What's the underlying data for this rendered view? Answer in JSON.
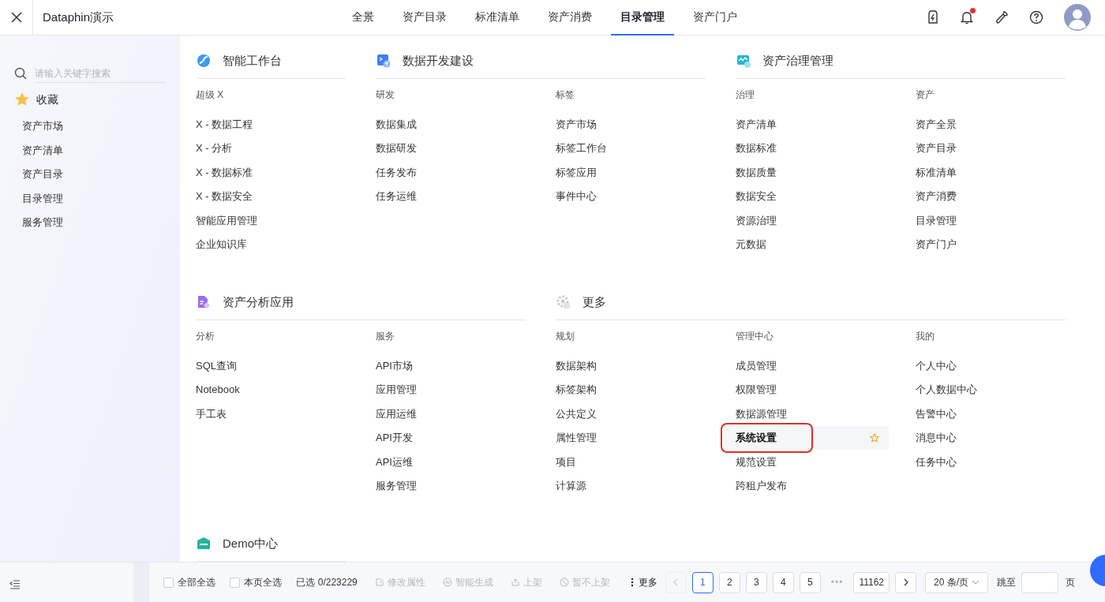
{
  "header": {
    "title": "Dataphin演示",
    "tabs": [
      {
        "label": "全景",
        "selected": false
      },
      {
        "label": "资产目录",
        "selected": false
      },
      {
        "label": "标准清单",
        "selected": false
      },
      {
        "label": "资产消费",
        "selected": false
      },
      {
        "label": "目录管理",
        "selected": true
      },
      {
        "label": "资产门户",
        "selected": false
      }
    ],
    "notification_dot": true
  },
  "sidebar": {
    "search": {
      "placeholder": "请输入关键字搜索"
    },
    "favorites": {
      "label": "收藏"
    },
    "items": [
      "资产市场",
      "资产清单",
      "资产目录",
      "目录管理",
      "服务管理"
    ]
  },
  "sections": [
    {
      "title": "智能工作台",
      "kind": "workbench",
      "groups": [
        {
          "title": "超级 X",
          "items": [
            {
              "label": "X - 数据工程",
              "hovered": false
            },
            {
              "label": "X - 分析",
              "hovered": false
            },
            {
              "label": "X - 数据标准",
              "hovered": false
            },
            {
              "label": "X - 数据安全",
              "hovered": false
            },
            {
              "label": "智能应用管理",
              "hovered": false
            },
            {
              "label": "企业知识库",
              "hovered": false
            }
          ]
        }
      ]
    },
    {
      "title": "数据开发建设",
      "kind": "develop",
      "groups": [
        {
          "title": "研发",
          "items": [
            {
              "label": "数据集成",
              "hovered": false
            },
            {
              "label": "数据研发",
              "hovered": false
            },
            {
              "label": "任务发布",
              "hovered": false
            },
            {
              "label": "任务运维",
              "hovered": false
            }
          ]
        },
        {
          "title": "标签",
          "items": [
            {
              "label": "资产市场",
              "hovered": false
            },
            {
              "label": "标签工作台",
              "hovered": false
            },
            {
              "label": "标签应用",
              "hovered": false
            },
            {
              "label": "事件中心",
              "hovered": false
            }
          ]
        }
      ]
    },
    {
      "title": "资产治理管理",
      "kind": "governance",
      "groups": [
        {
          "title": "治理",
          "items": [
            {
              "label": "资产清单",
              "hovered": false
            },
            {
              "label": "数据标准",
              "hovered": false
            },
            {
              "label": "数据质量",
              "hovered": false
            },
            {
              "label": "数据安全",
              "hovered": false
            },
            {
              "label": "资源治理",
              "hovered": false
            },
            {
              "label": "元数据",
              "hovered": false
            }
          ]
        },
        {
          "title": "资产",
          "items": [
            {
              "label": "资产全景",
              "hovered": false
            },
            {
              "label": "资产目录",
              "hovered": false
            },
            {
              "label": "标准清单",
              "hovered": false
            },
            {
              "label": "资产消费",
              "hovered": false
            },
            {
              "label": "目录管理",
              "hovered": false
            },
            {
              "label": "资产门户",
              "hovered": false
            }
          ]
        }
      ]
    },
    {
      "title": "资产分析应用",
      "kind": "analysis",
      "groups": [
        {
          "title": "分析",
          "items": [
            {
              "label": "SQL查询",
              "hovered": false
            },
            {
              "label": "Notebook",
              "hovered": false
            },
            {
              "label": "手工表",
              "hovered": false
            }
          ]
        },
        {
          "title": "服务",
          "items": [
            {
              "label": "API市场",
              "hovered": false
            },
            {
              "label": "应用管理",
              "hovered": false
            },
            {
              "label": "应用运维",
              "hovered": false
            },
            {
              "label": "API开发",
              "hovered": false
            },
            {
              "label": "API运维",
              "hovered": false
            },
            {
              "label": "服务管理",
              "hovered": false
            }
          ]
        }
      ]
    },
    {
      "title": "更多",
      "kind": "more",
      "groups": [
        {
          "title": "规划",
          "items": [
            {
              "label": "数据架构",
              "hovered": false
            },
            {
              "label": "标签架构",
              "hovered": false
            },
            {
              "label": "公共定义",
              "hovered": false
            },
            {
              "label": "属性管理",
              "hovered": false
            },
            {
              "label": "项目",
              "hovered": false
            },
            {
              "label": "计算源",
              "hovered": false
            }
          ]
        },
        {
          "title": "管理中心",
          "items": [
            {
              "label": "成员管理",
              "hovered": false
            },
            {
              "label": "权限管理",
              "hovered": false
            },
            {
              "label": "数据源管理",
              "hovered": false
            },
            {
              "label": "系统设置",
              "hovered": true
            },
            {
              "label": "规范设置",
              "hovered": false
            },
            {
              "label": "跨租户发布",
              "hovered": false
            }
          ]
        },
        {
          "title": "我的",
          "items": [
            {
              "label": "个人中心",
              "hovered": false
            },
            {
              "label": "个人数据中心",
              "hovered": false
            },
            {
              "label": "告警中心",
              "hovered": false
            },
            {
              "label": "消息中心",
              "hovered": false
            },
            {
              "label": "任务中心",
              "hovered": false
            }
          ]
        }
      ]
    },
    {
      "title": "Demo中心",
      "kind": "demo"
    }
  ],
  "toolbar": {
    "checks": [
      {
        "label": "全部全选",
        "checked": false
      },
      {
        "label": "本页全选",
        "checked": false
      }
    ],
    "selected_count": "已选 0/223229",
    "actions": [
      {
        "label": "修改属性",
        "kind": "edit",
        "disabled": true
      },
      {
        "label": "智能生成",
        "kind": "ai",
        "disabled": true
      },
      {
        "label": "上架",
        "kind": "publish",
        "disabled": true
      },
      {
        "label": "暂不上架",
        "kind": "ban",
        "disabled": true
      },
      {
        "label": "更多",
        "kind": "more",
        "disabled": false
      }
    ]
  },
  "pagination": {
    "pages": [
      {
        "label": "1",
        "selected": true
      },
      {
        "label": "2",
        "selected": false
      },
      {
        "label": "3",
        "selected": false
      },
      {
        "label": "4",
        "selected": false
      },
      {
        "label": "5",
        "selected": false
      },
      {
        "label": "•••",
        "kind": "ellipsis"
      },
      {
        "label": "11162",
        "selected": false
      }
    ],
    "prev_disabled": true,
    "page_size": "20 条/页",
    "jump_label": "跳至",
    "jump_suffix": "页"
  }
}
